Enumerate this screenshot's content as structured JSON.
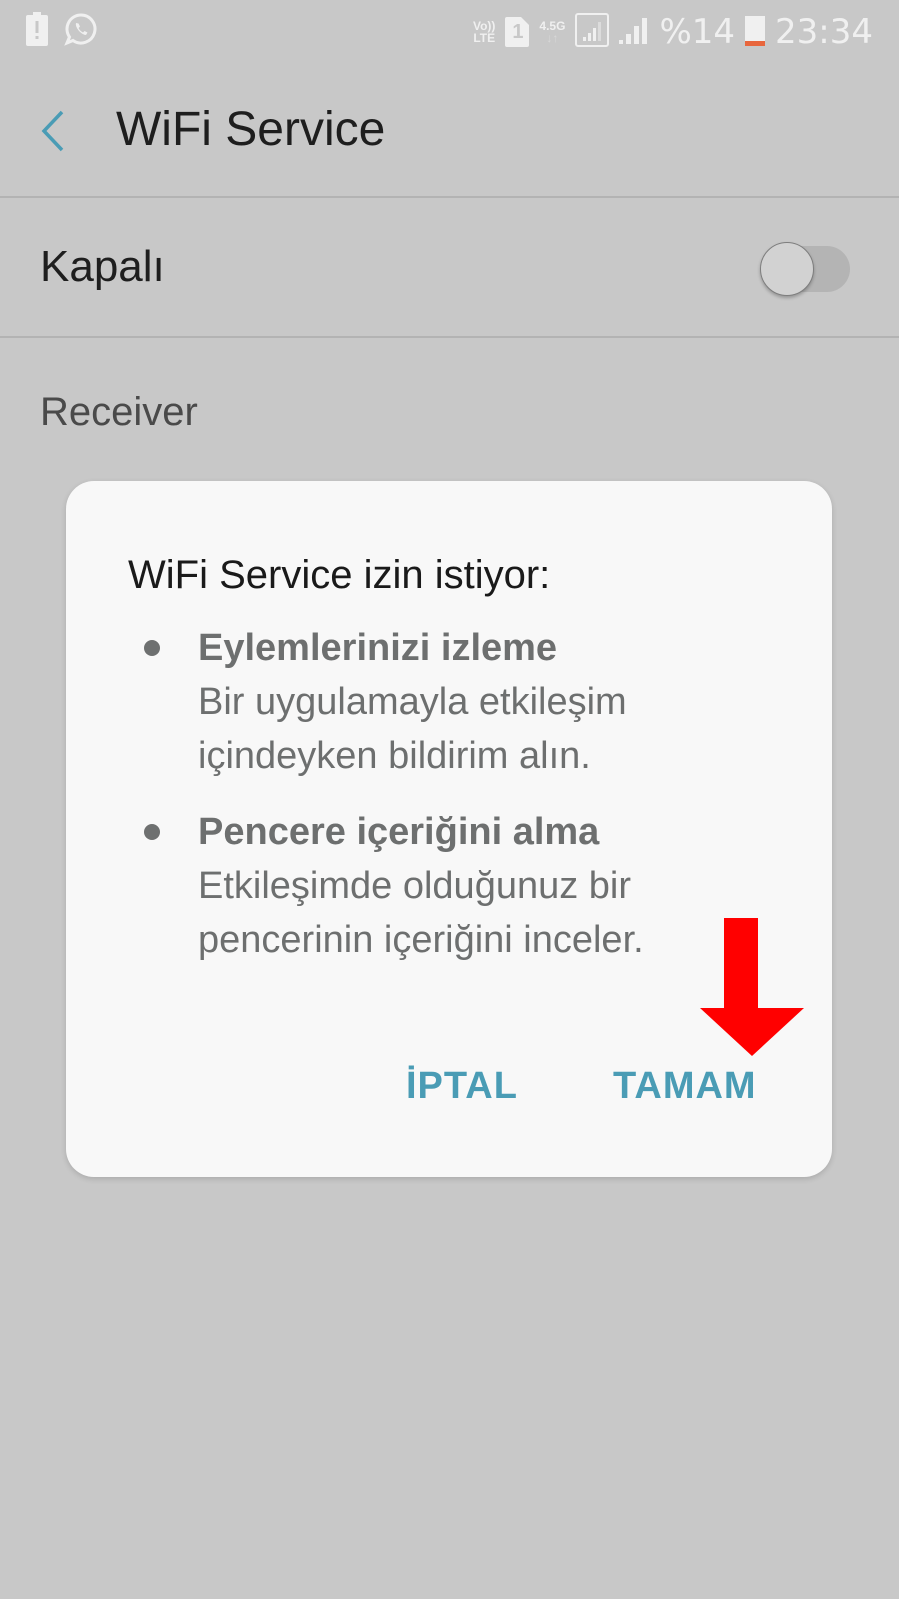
{
  "status_bar": {
    "left_icons": [
      "battery-alert-icon",
      "whatsapp-icon"
    ],
    "volte_top": "Vo))",
    "volte_bottom": "LTE",
    "sim_label": "1",
    "network_type": "4.5G",
    "battery_percent": "%14",
    "time": "23:34",
    "battery_level_color": "#e8663d"
  },
  "toolbar": {
    "title": "WiFi Service",
    "back_icon": "chevron-left-icon",
    "accent_color": "#4a9cb5"
  },
  "main_switch": {
    "label": "Kapalı",
    "state": "off"
  },
  "section": {
    "label": "Receiver"
  },
  "dialog": {
    "title": "WiFi Service izin istiyor:",
    "permissions": [
      {
        "title": "Eylemlerinizi izleme",
        "description": "Bir uygulamayla etkileşim içindeyken bildirim alın."
      },
      {
        "title": "Pencere içeriğini alma",
        "description": "Etkileşimde olduğunuz bir pencerinin içeriğini inceler."
      }
    ],
    "cancel_label": "İPTAL",
    "ok_label": "TAMAM",
    "button_color": "#4a9cb5"
  },
  "annotation": {
    "type": "arrow-down-icon",
    "color": "#ff0000",
    "points_to": "TAMAM"
  }
}
